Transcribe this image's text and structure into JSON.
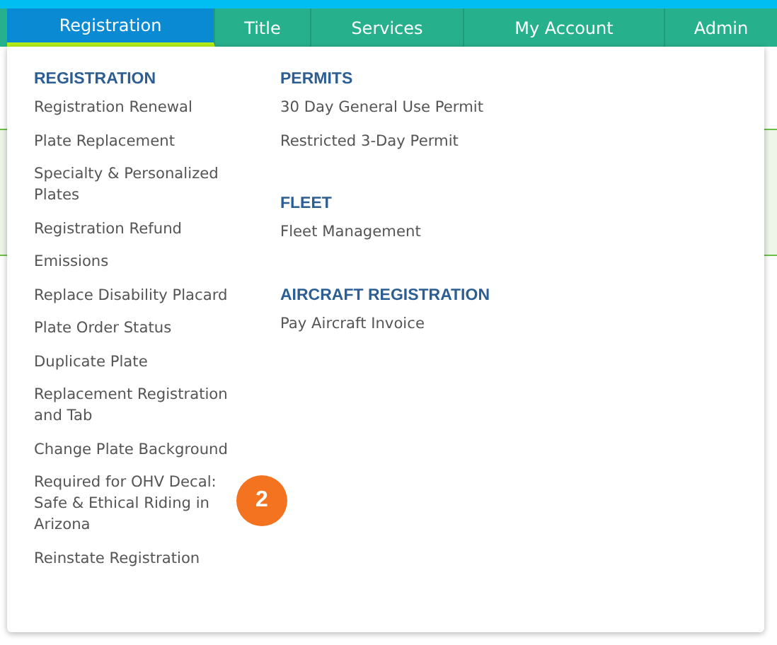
{
  "nav": {
    "tabs": [
      {
        "label": "Registration",
        "selected": true
      },
      {
        "label": "Title",
        "selected": false
      },
      {
        "label": "Services",
        "selected": false
      },
      {
        "label": "My Account",
        "selected": false
      },
      {
        "label": "Admin",
        "selected": false
      }
    ]
  },
  "menu": {
    "columns": [
      {
        "sections": [
          {
            "heading": "REGISTRATION",
            "items": [
              "Registration Renewal",
              "Plate Replacement",
              "Specialty & Personalized Plates",
              "Registration Refund",
              "Emissions",
              "Replace Disability Placard",
              "Plate Order Status",
              "Duplicate Plate",
              "Replacement Registration and Tab",
              "Change Plate Background",
              "Required for OHV Decal: Safe & Ethical Riding in Arizona",
              "Reinstate Registration"
            ]
          }
        ]
      },
      {
        "sections": [
          {
            "heading": "PERMITS",
            "items": [
              "30 Day General Use Permit",
              "Restricted 3-Day Permit"
            ]
          },
          {
            "heading": "FLEET",
            "items": [
              "Fleet Management"
            ]
          },
          {
            "heading": "AIRCRAFT REGISTRATION",
            "items": [
              "Pay Aircraft Invoice"
            ]
          }
        ]
      }
    ]
  },
  "callout": {
    "number": "2"
  }
}
